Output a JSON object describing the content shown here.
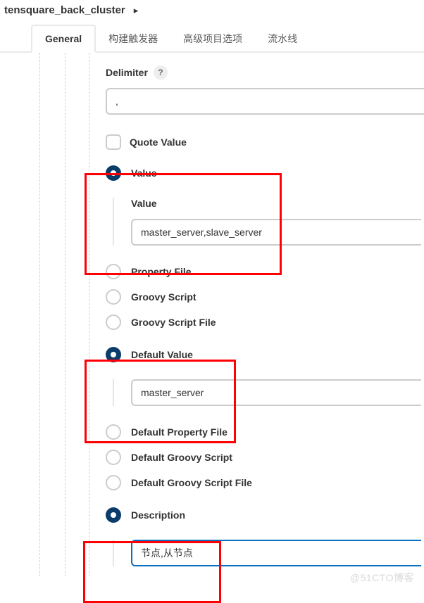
{
  "breadcrumb": {
    "title": "tensquare_back_cluster"
  },
  "tabs": {
    "general": "General",
    "build_triggers": "构建触发器",
    "advanced": "高级项目选项",
    "pipeline": "流水线"
  },
  "delimiter": {
    "label": "Delimiter",
    "value": ","
  },
  "quote_value": {
    "label": "Quote Value"
  },
  "value_section": {
    "radio_label": "Value",
    "sub_label": "Value",
    "input_value": "master_server,slave_server"
  },
  "radios1": {
    "property_file": "Property File",
    "groovy_script": "Groovy Script",
    "groovy_script_file": "Groovy Script File"
  },
  "default_value_section": {
    "radio_label": "Default Value",
    "input_value": "master_server"
  },
  "radios2": {
    "default_property_file": "Default Property File",
    "default_groovy_script": "Default Groovy Script",
    "default_groovy_script_file": "Default Groovy Script File"
  },
  "description_section": {
    "radio_label": "Description",
    "input_value": "节点,从节点"
  },
  "watermark": "@51CTO博客"
}
